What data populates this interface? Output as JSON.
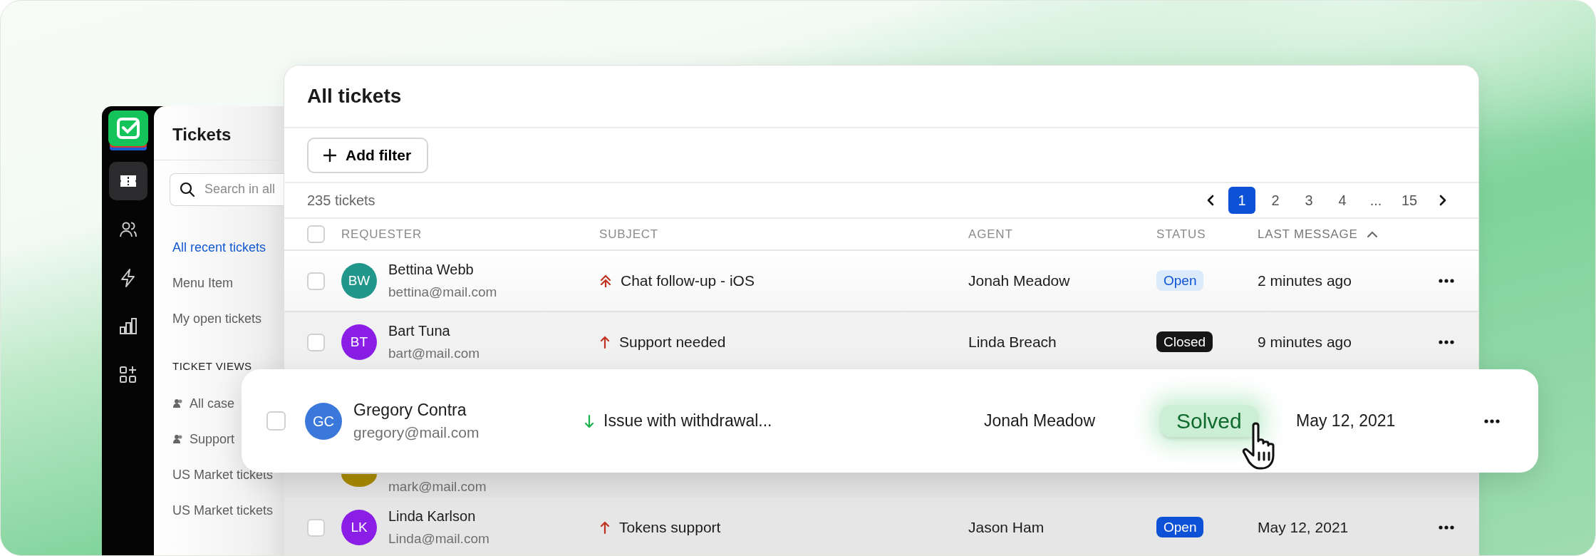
{
  "rail": {
    "items": [
      {
        "selected": true
      },
      {
        "selected": false
      },
      {
        "selected": false
      },
      {
        "selected": false
      },
      {
        "selected": false
      }
    ]
  },
  "sidebar": {
    "title": "Tickets",
    "search": {
      "placeholder": "Search in all"
    },
    "items": [
      {
        "label": "All recent tickets",
        "selected": true
      },
      {
        "label": "Menu Item",
        "selected": false
      },
      {
        "label": "My open tickets",
        "selected": false
      }
    ],
    "views_title": "TICKET VIEWS",
    "views": [
      {
        "label": "All case",
        "kind": "group"
      },
      {
        "label": "Support",
        "kind": "group"
      },
      {
        "label": "US Market tickets",
        "kind": "plain"
      },
      {
        "label": "US Market tickets",
        "kind": "plain"
      }
    ]
  },
  "main": {
    "title": "All tickets",
    "select_all": {
      "checked": false
    },
    "add_filter": "Add filter",
    "count": "235 tickets",
    "pagination": [
      {
        "label": "1",
        "selected": true
      },
      {
        "label": "2",
        "selected": false
      },
      {
        "label": "3",
        "selected": false
      },
      {
        "label": "4",
        "selected": false
      },
      {
        "label": "...",
        "selected": false
      },
      {
        "label": "15",
        "selected": false
      }
    ],
    "columns": [
      {
        "label": "REQUESTER",
        "sorted": false
      },
      {
        "label": "SUBJECT",
        "sorted": false
      },
      {
        "label": "AGENT",
        "sorted": false
      },
      {
        "label": "STATUS",
        "sorted": false
      },
      {
        "label": "LAST MESSAGE",
        "sorted": true
      }
    ],
    "rows": [
      {
        "checked": false,
        "initials": "BW",
        "color": "#21968a",
        "name": "Bettina Webb",
        "email": "bettina@mail.com",
        "priority": {
          "kind": "urgent"
        },
        "subject": "Chat follow-up - iOS",
        "agent": "Jonah Meadow",
        "status": {
          "label": "Open",
          "kind": "open-light"
        },
        "last_message": "2 minutes ago"
      },
      {
        "checked": false,
        "initials": "BT",
        "color": "#8a1ee6",
        "name": "Bart Tuna",
        "email": "bart@mail.com",
        "priority": {
          "kind": "high"
        },
        "subject": "Support needed",
        "agent": "Linda Breach",
        "status": {
          "label": "Closed",
          "kind": "closed"
        },
        "last_message": "9 minutes ago"
      },
      {
        "color": "#a88a00",
        "email": "mark@mail.com"
      },
      {
        "checked": false,
        "initials": "LK",
        "color": "#8a1ee6",
        "name": "Linda Karlson",
        "email": "Linda@mail.com",
        "priority": {
          "kind": "high"
        },
        "subject": "Tokens support",
        "agent": "Jason Ham",
        "status": {
          "label": "Open",
          "kind": "open-solid"
        },
        "last_message": "May 12, 2021"
      }
    ]
  },
  "featured_row": {
    "checked": false,
    "initials": "GC",
    "color": "#3a78dc",
    "name": "Gregory Contra",
    "email": "gregory@mail.com",
    "priority": {
      "kind": "low"
    },
    "subject": "Issue with withdrawal...",
    "agent": "Jonah Meadow",
    "status": {
      "label": "Solved",
      "kind": "solved"
    },
    "last_message": "May 12, 2021"
  }
}
